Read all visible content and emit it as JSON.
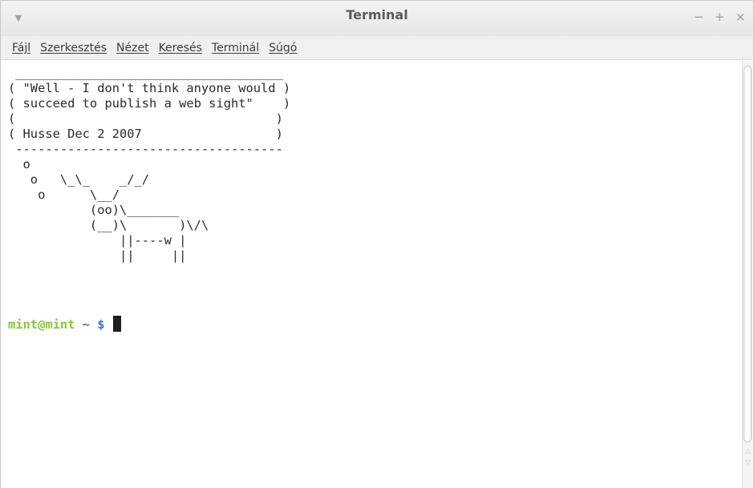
{
  "window": {
    "title": "Terminal",
    "menu_icon": "chevron-down-icon",
    "controls": {
      "minimize": "−",
      "maximize": "+",
      "close": "×"
    }
  },
  "menubar": {
    "items": [
      "Fájl",
      "Szerkesztés",
      "Nézet",
      "Keresés",
      "Terminál",
      "Súgó"
    ]
  },
  "terminal": {
    "output": " ____________________________________\n( \"Well - I don't think anyone would )\n( succeed to publish a web sight\"    )\n(                                   )\n( Husse Dec 2 2007                  )\n ------------------------------------\n  o\n   o   \\_\\_    _/_/\n    o      \\__/\n           (oo)\\_______\n           (__)\\       )\\/\\\n               ||----w |\n               ||     ||",
    "prompt_user": "mint@mint",
    "prompt_rest": " ~ $ ",
    "colors": {
      "user": "#88c63a",
      "path": "#3c74c4"
    }
  }
}
